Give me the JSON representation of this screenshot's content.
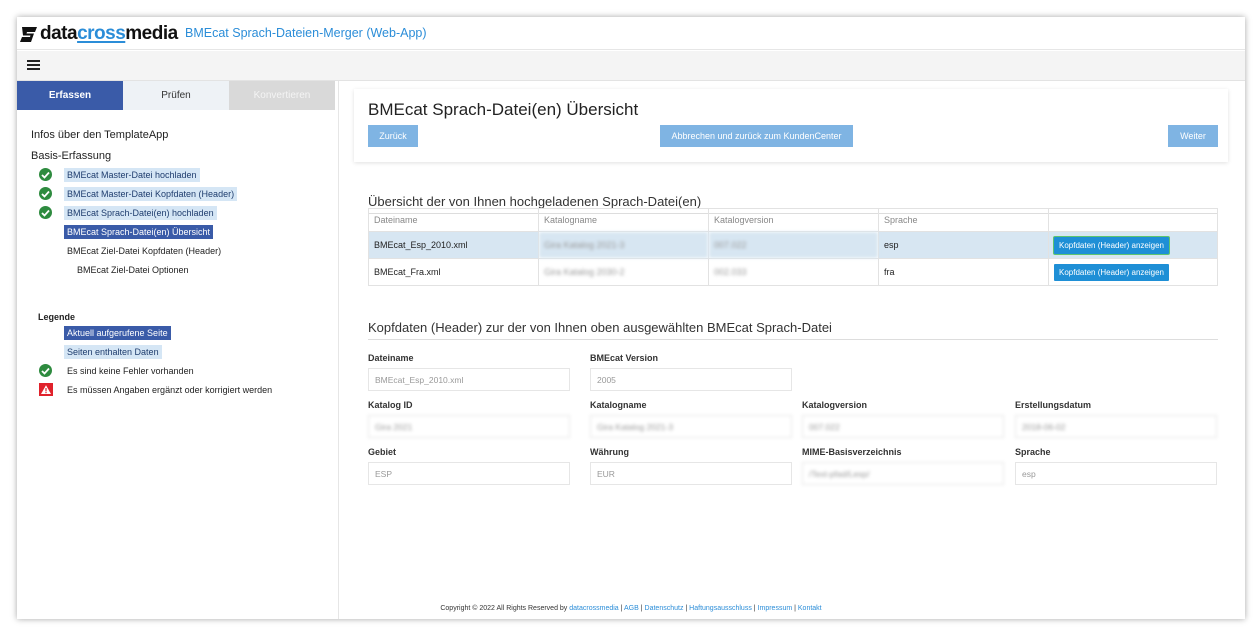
{
  "header": {
    "logo_pre": "data",
    "logo_accent": "cross",
    "logo_post": "media",
    "app_title": "BMEcat Sprach-Dateien-Merger (Web-App)"
  },
  "sidebar": {
    "tabs": [
      {
        "label": "Erfassen"
      },
      {
        "label": "Prüfen"
      },
      {
        "label": "Konvertieren"
      }
    ],
    "info_title": "Infos über den TemplateApp",
    "basis_title": "Basis-Erfassung",
    "steps": [
      {
        "label": "BMEcat Master-Datei hochladen",
        "status": "done"
      },
      {
        "label": "BMEcat Master-Datei Kopfdaten (Header)",
        "status": "done"
      },
      {
        "label": "BMEcat Sprach-Datei(en) hochladen",
        "status": "done"
      },
      {
        "label": "BMEcat Sprach-Datei(en) Übersicht",
        "status": "current"
      },
      {
        "label": "BMEcat Ziel-Datei Kopfdaten (Header)",
        "status": "open"
      },
      {
        "label": "BMEcat Ziel-Datei Optionen",
        "status": "open"
      }
    ],
    "legend": {
      "title": "Legende",
      "current": "Aktuell aufgerufene Seite",
      "has_data": "Seiten enthalten Daten",
      "no_errors": "Es sind keine Fehler vorhanden",
      "warning": "Es müssen Angaben ergänzt oder korrigiert werden"
    }
  },
  "main": {
    "title": "BMEcat Sprach-Datei(en) Übersicht",
    "btn_back": "Zurück",
    "btn_cancel": "Abbrechen und zurück zum KundenCenter",
    "btn_next": "Weiter",
    "upload_section": "Übersicht der von Ihnen hochgeladenen Sprach-Datei(en)",
    "table": {
      "headers": [
        "Dateiname",
        "Katalogname",
        "Katalogversion",
        "Sprache",
        ""
      ],
      "rows": [
        {
          "file": "BMEcat_Esp_2010.xml",
          "catalog": "Gira Katalog 2021-3",
          "version": "007.022",
          "lang": "esp",
          "action": "Kopfdaten (Header) anzeigen"
        },
        {
          "file": "BMEcat_Fra.xml",
          "catalog": "Gira Katalog 2030-2",
          "version": "002.033",
          "lang": "fra",
          "action": "Kopfdaten (Header) anzeigen"
        }
      ]
    },
    "header_section": "Kopfdaten (Header) zur der von Ihnen oben ausgewählten BMEcat Sprach-Datei",
    "fields": {
      "dateiname": {
        "label": "Dateiname",
        "value": "BMEcat_Esp_2010.xml"
      },
      "bmecat_version": {
        "label": "BMEcat Version",
        "value": "2005"
      },
      "katalog_id": {
        "label": "Katalog ID",
        "value": "Gira 2021"
      },
      "katalogname": {
        "label": "Katalogname",
        "value": "Gira Katalog 2021-3"
      },
      "katalogversion": {
        "label": "Katalogversion",
        "value": "007.022"
      },
      "erstellungsdatum": {
        "label": "Erstellungsdatum",
        "value": "2018-06-02"
      },
      "gebiet": {
        "label": "Gebiet",
        "value": "ESP"
      },
      "waehrung": {
        "label": "Währung",
        "value": "EUR"
      },
      "mime": {
        "label": "MIME-Basisverzeichnis",
        "value": "/Text-pfad/Lesp/"
      },
      "sprache": {
        "label": "Sprache",
        "value": "esp"
      }
    }
  },
  "footer": {
    "prefix": "Copyright © 2022 All Rights Reserved by",
    "links": [
      "datacrossmedia",
      "AGB",
      "Datenschutz",
      "Haftungsausschluss",
      "Impressum",
      "Kontakt"
    ]
  },
  "colors": {
    "primary": "#3a5ba8",
    "accent": "#2b8dd8",
    "button": "#7fb4e3",
    "success": "#2e8b3f",
    "warning": "#e0212b"
  }
}
